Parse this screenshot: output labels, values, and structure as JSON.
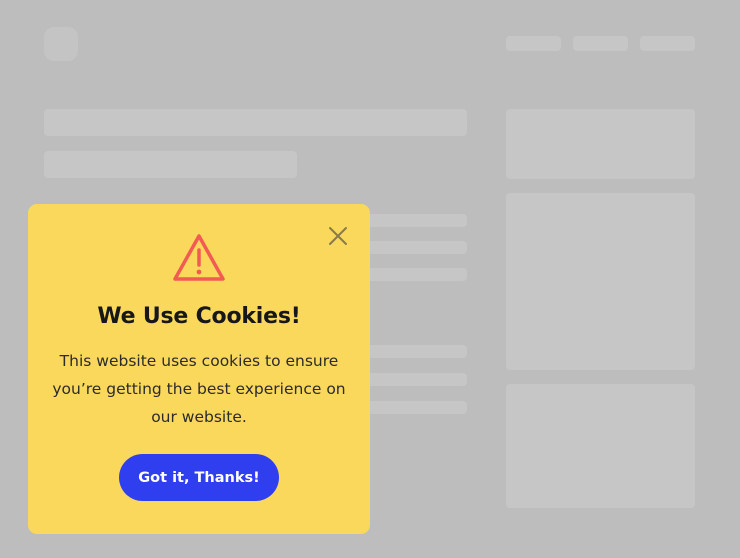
{
  "colors": {
    "backdrop": "#bdbdbd",
    "placeholder": "#c6c6c6",
    "modal_background": "#fad85c",
    "warning_icon": "#f25b54",
    "title_text": "#17171a",
    "button_background": "#2f3ff0",
    "button_text": "#ffffff"
  },
  "cookie_modal": {
    "title": "We Use Cookies!",
    "message": "This website uses cookies to ensure you’re getting the best experience on our website.",
    "accept_button_label": "Got it, Thanks!",
    "close_icon": "close-icon",
    "warning_icon": "warning-triangle-icon"
  }
}
